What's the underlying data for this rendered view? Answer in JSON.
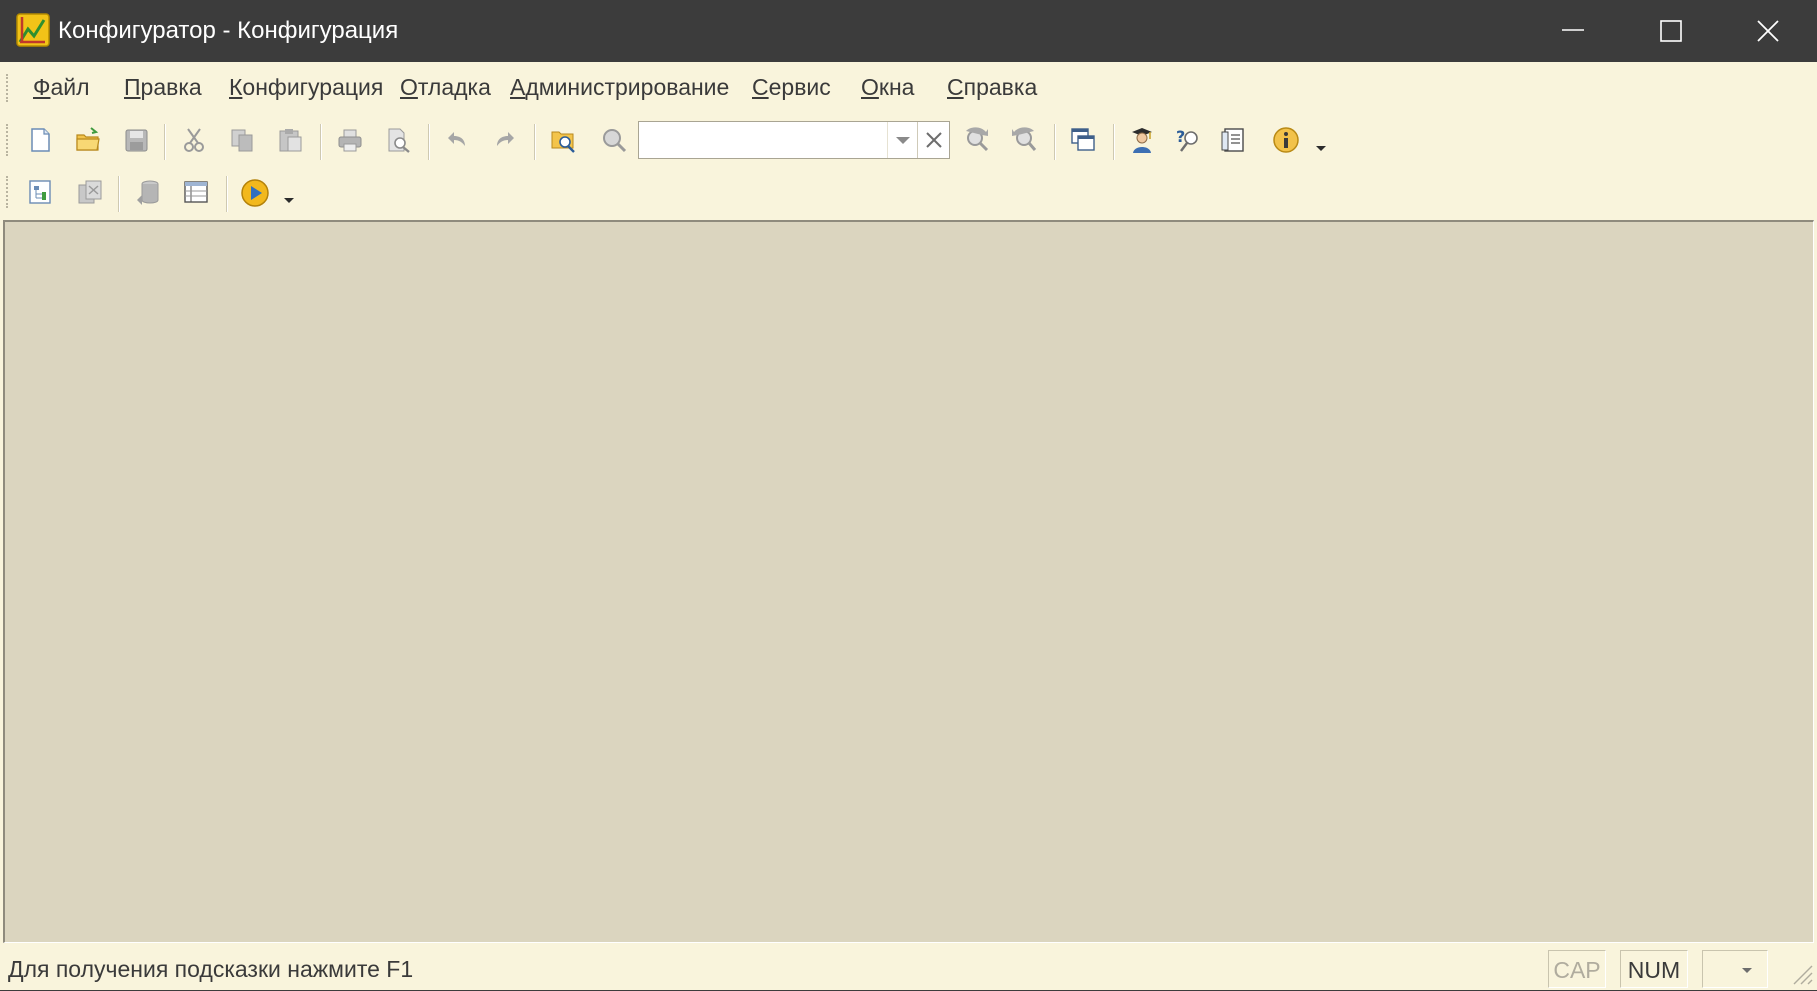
{
  "window": {
    "title": "Конфигуратор - Конфигурация",
    "controls": {
      "minimize": "minimize-icon",
      "maximize": "maximize-icon",
      "close": "close-icon"
    }
  },
  "menu": {
    "items": [
      {
        "id": "file",
        "pre": "",
        "ul": "Ф",
        "post": "айл"
      },
      {
        "id": "edit",
        "pre": "",
        "ul": "П",
        "post": "равка"
      },
      {
        "id": "config",
        "pre": "",
        "ul": "К",
        "post": "онфигурация"
      },
      {
        "id": "debug",
        "pre": "",
        "ul": "О",
        "post": "тладка"
      },
      {
        "id": "admin",
        "pre": "",
        "ul": "А",
        "post": "дминистрирование"
      },
      {
        "id": "service",
        "pre": "",
        "ul": "С",
        "post": "ервис"
      },
      {
        "id": "windows",
        "pre": "",
        "ul": "О",
        "post": "кна"
      },
      {
        "id": "help",
        "pre": "",
        "ul": "С",
        "post": "правка"
      }
    ]
  },
  "toolbar": {
    "search": {
      "value": "",
      "placeholder": ""
    },
    "icons": [
      "new-document-icon",
      "open-folder-icon",
      "save-icon",
      "cut-icon",
      "copy-icon",
      "paste-icon",
      "print-icon",
      "print-preview-icon",
      "undo-icon",
      "redo-icon",
      "find-icon",
      "search-icon",
      "find-next-icon",
      "find-previous-icon",
      "windows-icon",
      "assistant-icon",
      "help-search-icon",
      "help-contents-icon",
      "info-icon",
      "start-debug-icon"
    ]
  },
  "statusbar": {
    "hint": "Для получения подсказки нажмите F1",
    "cap": "CAP",
    "num": "NUM"
  },
  "colors": {
    "titlebar": "#3c3c3c",
    "frame": "#f9f4dc",
    "workspace": "#dbd5bf"
  }
}
